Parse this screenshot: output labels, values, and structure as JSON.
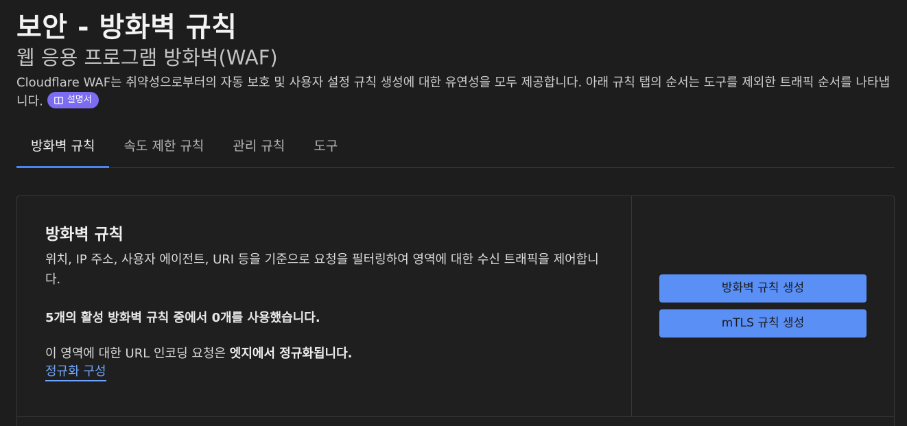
{
  "header": {
    "title": "보안 - 방화벽 규칙",
    "subtitle": "웹 응용 프로그램 방화벽(WAF)",
    "description": "Cloudflare WAF는 취약성으로부터의 자동 보호 및 사용자 설정 규칙 생성에 대한 유연성을 모두 제공합니다. 아래 규칙 탭의 순서는 도구를 제외한 트래픽 순서를 나타냅니다.",
    "docs_badge_label": "설명서",
    "docs_badge_icon": "book-icon",
    "docs_badge_color": "#7c6cf1"
  },
  "tabs": [
    {
      "label": "방화벽 규칙",
      "active": true
    },
    {
      "label": "속도 제한 규칙",
      "active": false
    },
    {
      "label": "관리 규칙",
      "active": false
    },
    {
      "label": "도구",
      "active": false
    }
  ],
  "card": {
    "title": "방화벽 규칙",
    "description": "위치, IP 주소, 사용자 에이전트, URI 등을 기준으로 요청을 필터링하여 영역에 대한 수신 트래픽을 제어합니다.",
    "usage": "5개의 활성 방화벽 규칙 중에서 0개를 사용했습니다.",
    "url_note_prefix": "이 영역에 대한 URL 인코딩 요청은 ",
    "url_note_bold": "엣지에서 정규화됩니다.",
    "normalization_link": "정규화 구성",
    "buttons": {
      "create_firewall_rule": "방화벽 규칙 생성",
      "create_mtls_rule": "mTLS 규칙 생성"
    }
  },
  "colors": {
    "accent": "#5a8ff5",
    "link": "#6ea6ff",
    "active_tab_underline": "#4a85f0",
    "background": "#1d1d1d"
  }
}
